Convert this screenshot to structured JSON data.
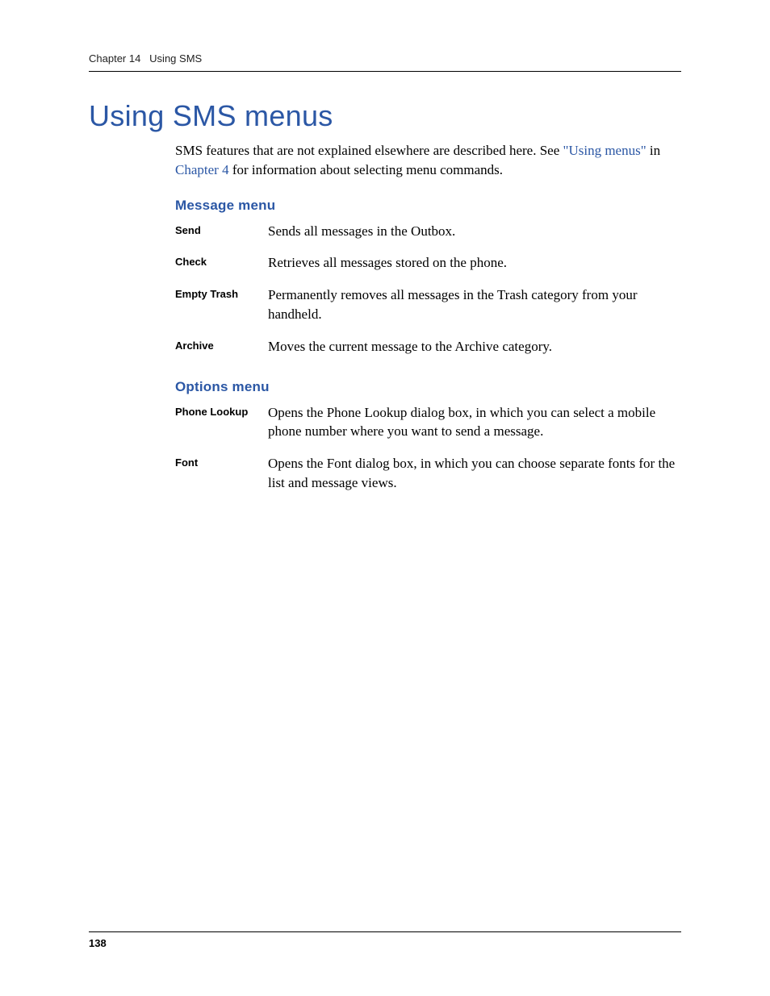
{
  "header": {
    "chapter_label": "Chapter 14",
    "chapter_title": "Using SMS"
  },
  "title": "Using SMS menus",
  "intro": {
    "prefix": "SMS features that are not explained elsewhere are described here. See ",
    "link1": "\"Using menus\"",
    "mid": " in ",
    "link2": "Chapter 4",
    "suffix": " for information about selecting menu commands."
  },
  "message_menu": {
    "heading": "Message menu",
    "items": [
      {
        "term": "Send",
        "desc": "Sends all messages in the Outbox."
      },
      {
        "term": "Check",
        "desc": "Retrieves all messages stored on the phone."
      },
      {
        "term": "Empty Trash",
        "desc": "Permanently removes all messages in the Trash category from your handheld."
      },
      {
        "term": "Archive",
        "desc": "Moves the current message to the Archive category."
      }
    ]
  },
  "options_menu": {
    "heading": "Options menu",
    "items": [
      {
        "term": "Phone Lookup",
        "desc": "Opens the Phone Lookup dialog box, in which you can select a mobile phone number where you want to send a message."
      },
      {
        "term": "Font",
        "desc": "Opens the Font dialog box, in which you can choose separate fonts for the list and message views."
      }
    ]
  },
  "page_number": "138"
}
